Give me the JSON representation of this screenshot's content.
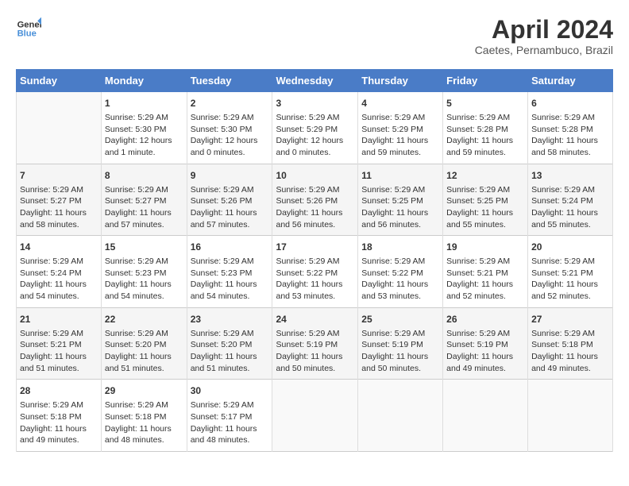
{
  "header": {
    "logo_line1": "General",
    "logo_line2": "Blue",
    "month": "April 2024",
    "location": "Caetes, Pernambuco, Brazil"
  },
  "days_of_week": [
    "Sunday",
    "Monday",
    "Tuesday",
    "Wednesday",
    "Thursday",
    "Friday",
    "Saturday"
  ],
  "weeks": [
    [
      {
        "day": "",
        "info": ""
      },
      {
        "day": "1",
        "info": "Sunrise: 5:29 AM\nSunset: 5:30 PM\nDaylight: 12 hours\nand 1 minute."
      },
      {
        "day": "2",
        "info": "Sunrise: 5:29 AM\nSunset: 5:30 PM\nDaylight: 12 hours\nand 0 minutes."
      },
      {
        "day": "3",
        "info": "Sunrise: 5:29 AM\nSunset: 5:29 PM\nDaylight: 12 hours\nand 0 minutes."
      },
      {
        "day": "4",
        "info": "Sunrise: 5:29 AM\nSunset: 5:29 PM\nDaylight: 11 hours\nand 59 minutes."
      },
      {
        "day": "5",
        "info": "Sunrise: 5:29 AM\nSunset: 5:28 PM\nDaylight: 11 hours\nand 59 minutes."
      },
      {
        "day": "6",
        "info": "Sunrise: 5:29 AM\nSunset: 5:28 PM\nDaylight: 11 hours\nand 58 minutes."
      }
    ],
    [
      {
        "day": "7",
        "info": "Sunrise: 5:29 AM\nSunset: 5:27 PM\nDaylight: 11 hours\nand 58 minutes."
      },
      {
        "day": "8",
        "info": "Sunrise: 5:29 AM\nSunset: 5:27 PM\nDaylight: 11 hours\nand 57 minutes."
      },
      {
        "day": "9",
        "info": "Sunrise: 5:29 AM\nSunset: 5:26 PM\nDaylight: 11 hours\nand 57 minutes."
      },
      {
        "day": "10",
        "info": "Sunrise: 5:29 AM\nSunset: 5:26 PM\nDaylight: 11 hours\nand 56 minutes."
      },
      {
        "day": "11",
        "info": "Sunrise: 5:29 AM\nSunset: 5:25 PM\nDaylight: 11 hours\nand 56 minutes."
      },
      {
        "day": "12",
        "info": "Sunrise: 5:29 AM\nSunset: 5:25 PM\nDaylight: 11 hours\nand 55 minutes."
      },
      {
        "day": "13",
        "info": "Sunrise: 5:29 AM\nSunset: 5:24 PM\nDaylight: 11 hours\nand 55 minutes."
      }
    ],
    [
      {
        "day": "14",
        "info": "Sunrise: 5:29 AM\nSunset: 5:24 PM\nDaylight: 11 hours\nand 54 minutes."
      },
      {
        "day": "15",
        "info": "Sunrise: 5:29 AM\nSunset: 5:23 PM\nDaylight: 11 hours\nand 54 minutes."
      },
      {
        "day": "16",
        "info": "Sunrise: 5:29 AM\nSunset: 5:23 PM\nDaylight: 11 hours\nand 54 minutes."
      },
      {
        "day": "17",
        "info": "Sunrise: 5:29 AM\nSunset: 5:22 PM\nDaylight: 11 hours\nand 53 minutes."
      },
      {
        "day": "18",
        "info": "Sunrise: 5:29 AM\nSunset: 5:22 PM\nDaylight: 11 hours\nand 53 minutes."
      },
      {
        "day": "19",
        "info": "Sunrise: 5:29 AM\nSunset: 5:21 PM\nDaylight: 11 hours\nand 52 minutes."
      },
      {
        "day": "20",
        "info": "Sunrise: 5:29 AM\nSunset: 5:21 PM\nDaylight: 11 hours\nand 52 minutes."
      }
    ],
    [
      {
        "day": "21",
        "info": "Sunrise: 5:29 AM\nSunset: 5:21 PM\nDaylight: 11 hours\nand 51 minutes."
      },
      {
        "day": "22",
        "info": "Sunrise: 5:29 AM\nSunset: 5:20 PM\nDaylight: 11 hours\nand 51 minutes."
      },
      {
        "day": "23",
        "info": "Sunrise: 5:29 AM\nSunset: 5:20 PM\nDaylight: 11 hours\nand 51 minutes."
      },
      {
        "day": "24",
        "info": "Sunrise: 5:29 AM\nSunset: 5:19 PM\nDaylight: 11 hours\nand 50 minutes."
      },
      {
        "day": "25",
        "info": "Sunrise: 5:29 AM\nSunset: 5:19 PM\nDaylight: 11 hours\nand 50 minutes."
      },
      {
        "day": "26",
        "info": "Sunrise: 5:29 AM\nSunset: 5:19 PM\nDaylight: 11 hours\nand 49 minutes."
      },
      {
        "day": "27",
        "info": "Sunrise: 5:29 AM\nSunset: 5:18 PM\nDaylight: 11 hours\nand 49 minutes."
      }
    ],
    [
      {
        "day": "28",
        "info": "Sunrise: 5:29 AM\nSunset: 5:18 PM\nDaylight: 11 hours\nand 49 minutes."
      },
      {
        "day": "29",
        "info": "Sunrise: 5:29 AM\nSunset: 5:18 PM\nDaylight: 11 hours\nand 48 minutes."
      },
      {
        "day": "30",
        "info": "Sunrise: 5:29 AM\nSunset: 5:17 PM\nDaylight: 11 hours\nand 48 minutes."
      },
      {
        "day": "",
        "info": ""
      },
      {
        "day": "",
        "info": ""
      },
      {
        "day": "",
        "info": ""
      },
      {
        "day": "",
        "info": ""
      }
    ]
  ]
}
